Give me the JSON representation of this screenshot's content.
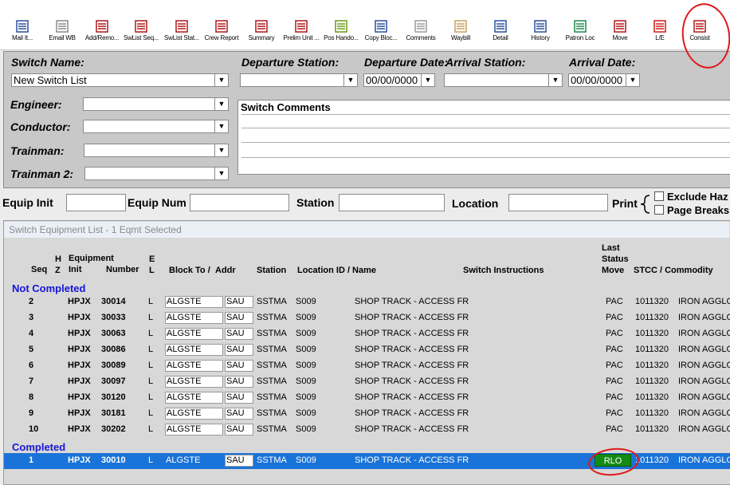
{
  "toolbar": {
    "buttons": [
      {
        "label": "Mail It...",
        "icon": "mail-icon"
      },
      {
        "label": "Email WB",
        "icon": "email-icon"
      },
      {
        "label": "Add/Remo...",
        "icon": "add-remove-icon"
      },
      {
        "label": "SwList Seq...",
        "icon": "swlist-seq-icon"
      },
      {
        "label": "SwList Stat...",
        "icon": "swlist-stat-icon"
      },
      {
        "label": "Crew Report",
        "icon": "crew-report-icon"
      },
      {
        "label": "Summary",
        "icon": "summary-icon"
      },
      {
        "label": "Prelim Unit ...",
        "icon": "prelim-unit-icon"
      },
      {
        "label": "Pos Hando...",
        "icon": "pos-handoff-icon"
      },
      {
        "label": "Copy Bloc...",
        "icon": "copy-block-icon"
      },
      {
        "label": "Comments",
        "icon": "comments-icon"
      },
      {
        "label": "Waybill",
        "icon": "waybill-icon"
      },
      {
        "label": "Detail",
        "icon": "detail-icon"
      },
      {
        "label": "History",
        "icon": "history-icon"
      },
      {
        "label": "Patron Loc",
        "icon": "patron-loc-icon"
      },
      {
        "label": "Move",
        "icon": "move-icon"
      },
      {
        "label": "L/E",
        "icon": "le-icon"
      },
      {
        "label": "Consist",
        "icon": "consist-icon"
      }
    ]
  },
  "header": {
    "switch_name_label": "Switch Name:",
    "switch_name_value": "New Switch List",
    "departure_station_label": "Departure Station:",
    "departure_station_value": "",
    "departure_date_label": "Departure Date:",
    "departure_date_value": "00/00/0000",
    "arrival_station_label": "Arrival Station:",
    "arrival_station_value": "",
    "arrival_date_label": "Arrival Date:",
    "arrival_date_value": "00/00/0000",
    "engineer_label": "Engineer:",
    "conductor_label": "Conductor:",
    "trainman_label": "Trainman:",
    "trainman2_label": "Trainman 2:",
    "switch_comments_label": "Switch Comments"
  },
  "filter": {
    "equip_init_label": "Equip Init",
    "equip_num_label": "Equip Num",
    "station_label": "Station",
    "location_label": "Location",
    "print_label": "Print",
    "exclude_haz_label": "Exclude Haz",
    "page_breaks_label": "Page Breaks"
  },
  "list": {
    "title": "Switch Equipment List - 1 Eqmt Selected",
    "headers": {
      "seq": "Seq",
      "hz": "H\nZ",
      "equipment": "Equipment",
      "init": "Init",
      "number": "Number",
      "el": "E\nL",
      "block_to": "Block To /",
      "addr": "Addr",
      "station": "Station",
      "location": "Location ID / Name",
      "instructions": "Switch Instructions",
      "last_status": "Last\nStatus\nMove",
      "stcc": "STCC / Commodity"
    },
    "not_completed_label": "Not Completed",
    "completed_label": "Completed",
    "not_completed_rows": [
      {
        "seq": "2",
        "init": "HPJX",
        "number": "30014",
        "el": "L",
        "block": "ALGSTE",
        "addr": "SAU",
        "station": "SSTMA",
        "loc": "S009",
        "name": "SHOP TRACK - ACCESS FR",
        "status": "PAC",
        "stcc": "1011320",
        "commodity": "IRON AGGLO"
      },
      {
        "seq": "3",
        "init": "HPJX",
        "number": "30033",
        "el": "L",
        "block": "ALGSTE",
        "addr": "SAU",
        "station": "SSTMA",
        "loc": "S009",
        "name": "SHOP TRACK - ACCESS FR",
        "status": "PAC",
        "stcc": "1011320",
        "commodity": "IRON AGGLO"
      },
      {
        "seq": "4",
        "init": "HPJX",
        "number": "30063",
        "el": "L",
        "block": "ALGSTE",
        "addr": "SAU",
        "station": "SSTMA",
        "loc": "S009",
        "name": "SHOP TRACK - ACCESS FR",
        "status": "PAC",
        "stcc": "1011320",
        "commodity": "IRON AGGLO"
      },
      {
        "seq": "5",
        "init": "HPJX",
        "number": "30086",
        "el": "L",
        "block": "ALGSTE",
        "addr": "SAU",
        "station": "SSTMA",
        "loc": "S009",
        "name": "SHOP TRACK - ACCESS FR",
        "status": "PAC",
        "stcc": "1011320",
        "commodity": "IRON AGGLO"
      },
      {
        "seq": "6",
        "init": "HPJX",
        "number": "30089",
        "el": "L",
        "block": "ALGSTE",
        "addr": "SAU",
        "station": "SSTMA",
        "loc": "S009",
        "name": "SHOP TRACK - ACCESS FR",
        "status": "PAC",
        "stcc": "1011320",
        "commodity": "IRON AGGLO"
      },
      {
        "seq": "7",
        "init": "HPJX",
        "number": "30097",
        "el": "L",
        "block": "ALGSTE",
        "addr": "SAU",
        "station": "SSTMA",
        "loc": "S009",
        "name": "SHOP TRACK - ACCESS FR",
        "status": "PAC",
        "stcc": "1011320",
        "commodity": "IRON AGGLO"
      },
      {
        "seq": "8",
        "init": "HPJX",
        "number": "30120",
        "el": "L",
        "block": "ALGSTE",
        "addr": "SAU",
        "station": "SSTMA",
        "loc": "S009",
        "name": "SHOP TRACK - ACCESS FR",
        "status": "PAC",
        "stcc": "1011320",
        "commodity": "IRON AGGLO"
      },
      {
        "seq": "9",
        "init": "HPJX",
        "number": "30181",
        "el": "L",
        "block": "ALGSTE",
        "addr": "SAU",
        "station": "SSTMA",
        "loc": "S009",
        "name": "SHOP TRACK - ACCESS FR",
        "status": "PAC",
        "stcc": "1011320",
        "commodity": "IRON AGGLO"
      },
      {
        "seq": "10",
        "init": "HPJX",
        "number": "30202",
        "el": "L",
        "block": "ALGSTE",
        "addr": "SAU",
        "station": "SSTMA",
        "loc": "S009",
        "name": "SHOP TRACK - ACCESS FR",
        "status": "PAC",
        "stcc": "1011320",
        "commodity": "IRON AGGLO"
      }
    ],
    "completed_rows": [
      {
        "seq": "1",
        "init": "HPJX",
        "number": "30010",
        "el": "L",
        "block": "ALGSTE",
        "addr": "SAU",
        "station": "SSTMA",
        "loc": "S009",
        "name": "SHOP TRACK - ACCESS FR",
        "status": "RLO",
        "stcc": "1011320",
        "commodity": "IRON AGGLO"
      }
    ]
  },
  "colors": {
    "selected_row": "#1a73d8",
    "status_rlo": "#148b14",
    "section_label": "#1515d8",
    "annotation": "#e01818"
  }
}
